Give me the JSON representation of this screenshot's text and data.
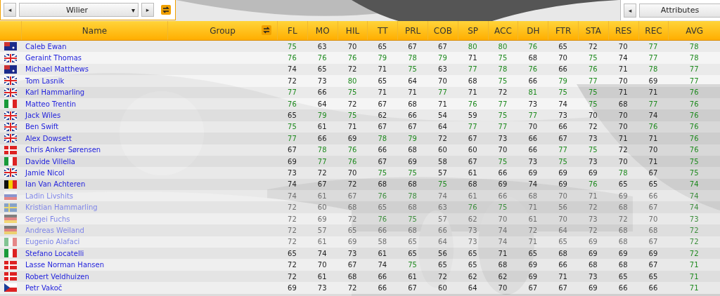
{
  "team_selector": {
    "prev": "◂",
    "value": "Wilier",
    "caret": "▾",
    "next": "▸"
  },
  "view_selector": {
    "prev": "◂",
    "value": "Attributes"
  },
  "columns": [
    "Name",
    "Group",
    "FL",
    "MO",
    "HIL",
    "TT",
    "PRL",
    "COB",
    "SP",
    "ACC",
    "DH",
    "FTR",
    "STA",
    "RES",
    "REC",
    "AVG"
  ],
  "riders": [
    {
      "kind": "au",
      "name": "Caleb Ewan",
      "faded": false,
      "values": [
        "75",
        "63",
        "70",
        "65",
        "67",
        "67",
        "80",
        "80",
        "76",
        "65",
        "72",
        "70",
        "77",
        "78"
      ]
    },
    {
      "kind": "gb",
      "name": "Geraint Thomas",
      "faded": false,
      "values": [
        "76",
        "76",
        "76",
        "79",
        "78",
        "79",
        "71",
        "75",
        "68",
        "70",
        "75",
        "74",
        "77",
        "78"
      ]
    },
    {
      "kind": "au",
      "name": "Michael Matthews",
      "faded": false,
      "values": [
        "74",
        "65",
        "72",
        "71",
        "75",
        "63",
        "77",
        "78",
        "76",
        "66",
        "76",
        "71",
        "78",
        "77"
      ]
    },
    {
      "kind": "gb",
      "name": "Tom Lasnik",
      "faded": false,
      "values": [
        "72",
        "73",
        "80",
        "65",
        "64",
        "70",
        "68",
        "75",
        "66",
        "79",
        "77",
        "70",
        "69",
        "77"
      ]
    },
    {
      "kind": "gb",
      "name": "Karl Hammarling",
      "faded": false,
      "values": [
        "77",
        "66",
        "75",
        "71",
        "71",
        "77",
        "71",
        "72",
        "81",
        "75",
        "75",
        "71",
        "71",
        "76"
      ]
    },
    {
      "kind": "it",
      "name": "Matteo Trentin",
      "faded": false,
      "values": [
        "76",
        "64",
        "72",
        "67",
        "68",
        "71",
        "76",
        "77",
        "73",
        "74",
        "75",
        "68",
        "77",
        "76"
      ]
    },
    {
      "kind": "gb",
      "name": "Jack Wiles",
      "faded": false,
      "values": [
        "65",
        "79",
        "75",
        "62",
        "66",
        "54",
        "59",
        "75",
        "77",
        "73",
        "70",
        "70",
        "74",
        "76"
      ]
    },
    {
      "kind": "gb",
      "name": "Ben Swift",
      "faded": false,
      "values": [
        "75",
        "61",
        "71",
        "67",
        "67",
        "64",
        "77",
        "77",
        "70",
        "66",
        "72",
        "70",
        "76",
        "76"
      ]
    },
    {
      "kind": "gb",
      "name": "Alex Dowsett",
      "faded": false,
      "values": [
        "77",
        "66",
        "69",
        "78",
        "79",
        "72",
        "67",
        "73",
        "66",
        "67",
        "73",
        "71",
        "71",
        "76"
      ]
    },
    {
      "kind": "dk",
      "name": "Chris Anker Sørensen",
      "faded": false,
      "values": [
        "67",
        "78",
        "76",
        "66",
        "68",
        "60",
        "60",
        "70",
        "66",
        "77",
        "75",
        "72",
        "70",
        "76"
      ]
    },
    {
      "kind": "it",
      "name": "Davide Villella",
      "faded": false,
      "values": [
        "69",
        "77",
        "76",
        "67",
        "69",
        "58",
        "67",
        "75",
        "73",
        "75",
        "73",
        "70",
        "71",
        "75"
      ]
    },
    {
      "kind": "gb",
      "name": "Jamie Nicol",
      "faded": false,
      "values": [
        "73",
        "72",
        "70",
        "75",
        "75",
        "57",
        "61",
        "66",
        "69",
        "69",
        "69",
        "78",
        "67",
        "75"
      ]
    },
    {
      "kind": "be",
      "name": "Ian Van Achteren",
      "faded": false,
      "values": [
        "74",
        "67",
        "72",
        "68",
        "68",
        "75",
        "68",
        "69",
        "74",
        "69",
        "76",
        "65",
        "65",
        "74"
      ]
    },
    {
      "kind": "ru",
      "name": "Ladin Livshits",
      "faded": true,
      "values": [
        "74",
        "61",
        "67",
        "76",
        "78",
        "74",
        "61",
        "66",
        "68",
        "70",
        "71",
        "69",
        "66",
        "74"
      ]
    },
    {
      "kind": "se",
      "name": "Kristian Hammarling",
      "faded": true,
      "values": [
        "72",
        "60",
        "68",
        "65",
        "68",
        "63",
        "76",
        "75",
        "71",
        "56",
        "72",
        "68",
        "67",
        "74"
      ]
    },
    {
      "kind": "de",
      "name": "Sergei Fuchs",
      "faded": true,
      "values": [
        "72",
        "69",
        "72",
        "76",
        "75",
        "57",
        "62",
        "70",
        "61",
        "70",
        "73",
        "72",
        "70",
        "73"
      ]
    },
    {
      "kind": "de",
      "name": "Andreas Weiland",
      "faded": true,
      "values": [
        "72",
        "57",
        "65",
        "66",
        "68",
        "66",
        "73",
        "74",
        "72",
        "64",
        "72",
        "68",
        "68",
        "72"
      ]
    },
    {
      "kind": "it",
      "name": "Eugenio Alafaci",
      "faded": true,
      "values": [
        "72",
        "61",
        "69",
        "58",
        "65",
        "64",
        "73",
        "74",
        "71",
        "65",
        "69",
        "68",
        "67",
        "72"
      ]
    },
    {
      "kind": "it",
      "name": "Stefano Locatelli",
      "faded": false,
      "values": [
        "65",
        "74",
        "73",
        "61",
        "65",
        "56",
        "65",
        "71",
        "65",
        "68",
        "69",
        "69",
        "69",
        "72"
      ]
    },
    {
      "kind": "dk",
      "name": "Lasse Norman Hansen",
      "faded": false,
      "values": [
        "72",
        "70",
        "67",
        "74",
        "75",
        "65",
        "65",
        "68",
        "69",
        "66",
        "68",
        "68",
        "67",
        "71"
      ]
    },
    {
      "kind": "dk",
      "name": "Robert Veldhuizen",
      "faded": false,
      "values": [
        "72",
        "61",
        "68",
        "66",
        "61",
        "72",
        "62",
        "62",
        "69",
        "71",
        "73",
        "65",
        "65",
        "71"
      ]
    },
    {
      "kind": "cz",
      "name": "Petr Vakoč",
      "faded": false,
      "values": [
        "69",
        "73",
        "72",
        "66",
        "67",
        "60",
        "64",
        "70",
        "67",
        "67",
        "69",
        "66",
        "66",
        "71"
      ]
    }
  ]
}
